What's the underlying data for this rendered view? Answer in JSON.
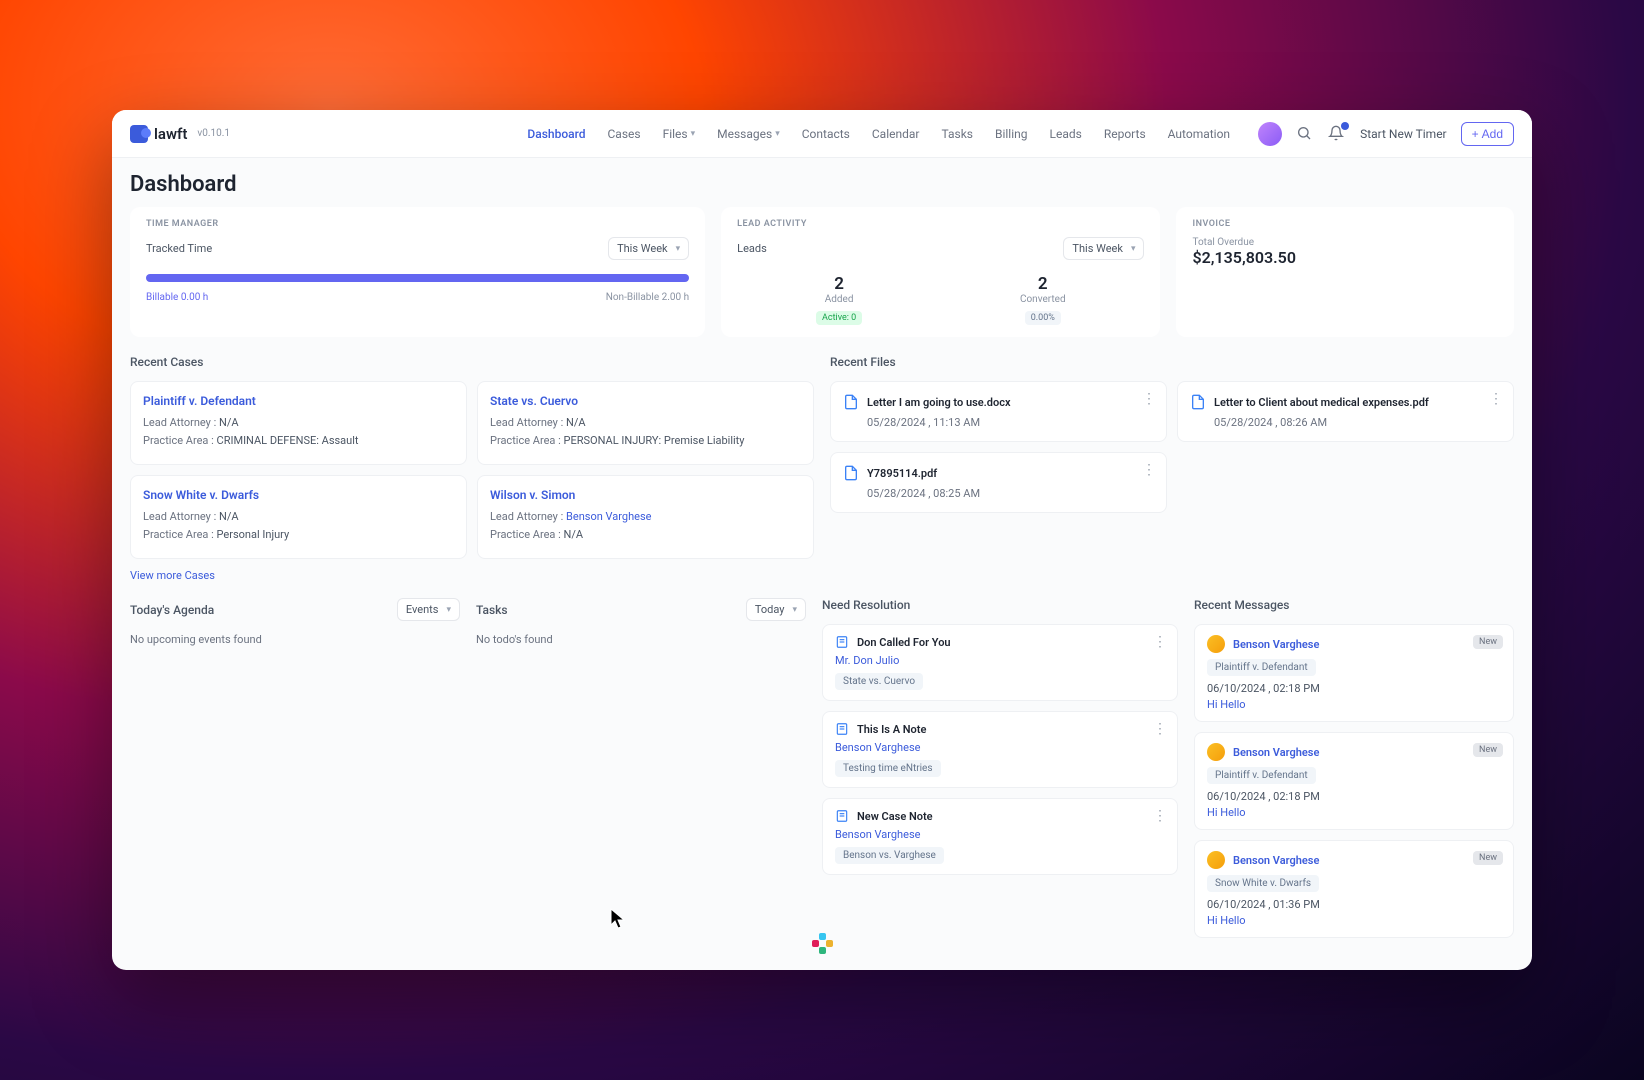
{
  "brand": {
    "name": "lawft",
    "version": "v0.10.1"
  },
  "nav": {
    "dashboard": "Dashboard",
    "cases": "Cases",
    "files": "Files",
    "messages": "Messages",
    "contacts": "Contacts",
    "calendar": "Calendar",
    "tasks": "Tasks",
    "billing": "Billing",
    "leads": "Leads",
    "reports": "Reports",
    "automation": "Automation"
  },
  "top": {
    "timer": "Start New Timer",
    "add": "Add"
  },
  "page_title": "Dashboard",
  "time_manager": {
    "label": "TIME MANAGER",
    "tracked": "Tracked Time",
    "range": "This Week",
    "billable_label": "Billable",
    "billable_val": "0.00 h",
    "nonbillable_label": "Non-Billable",
    "nonbillable_val": "2.00 h"
  },
  "lead_activity": {
    "label": "LEAD ACTIVITY",
    "leads": "Leads",
    "range": "This Week",
    "added": {
      "count": "2",
      "label": "Added",
      "pill": "Active: 0"
    },
    "converted": {
      "count": "2",
      "label": "Converted",
      "pill": "0.00%"
    }
  },
  "invoice": {
    "label": "INVOICE",
    "overdue_label": "Total Overdue",
    "overdue_amount": "$2,135,803.50"
  },
  "recent_cases": {
    "title": "Recent Cases",
    "view_more": "View more Cases",
    "items": [
      {
        "name": "Plaintiff v. Defendant",
        "attorney_label": "Lead Attorney :",
        "attorney": "N/A",
        "area_label": "Practice Area :",
        "area": "CRIMINAL DEFENSE: Assault"
      },
      {
        "name": "State vs. Cuervo",
        "attorney_label": "Lead Attorney :",
        "attorney": "N/A",
        "area_label": "Practice Area :",
        "area": "PERSONAL INJURY: Premise Liability"
      },
      {
        "name": "Snow White v. Dwarfs",
        "attorney_label": "Lead Attorney :",
        "attorney": "N/A",
        "area_label": "Practice Area :",
        "area": "Personal Injury"
      },
      {
        "name": "Wilson v. Simon",
        "attorney_label": "Lead Attorney :",
        "attorney": "Benson Varghese",
        "attorney_link": true,
        "area_label": "Practice Area :",
        "area": "N/A"
      }
    ]
  },
  "recent_files": {
    "title": "Recent Files",
    "items": [
      {
        "name": "Letter I am going to use.docx",
        "time": "05/28/2024 , 11:13 AM"
      },
      {
        "name": "Letter to Client about medical expenses.pdf",
        "time": "05/28/2024 , 08:26 AM"
      },
      {
        "name": "Y7895114.pdf",
        "time": "05/28/2024 , 08:25 AM"
      }
    ]
  },
  "agenda": {
    "title": "Today's Agenda",
    "range": "Events",
    "empty": "No upcoming events found"
  },
  "tasks": {
    "title": "Tasks",
    "range": "Today",
    "empty": "No todo's found"
  },
  "resolution": {
    "title": "Need Resolution",
    "items": [
      {
        "subject": "Don Called For You",
        "person": "Mr. Don Julio",
        "tag": "State vs. Cuervo"
      },
      {
        "subject": "This Is A Note",
        "person": "Benson Varghese",
        "tag": "Testing time eNtries"
      },
      {
        "subject": "New Case Note",
        "person": "Benson Varghese",
        "tag": "Benson vs. Varghese"
      }
    ]
  },
  "messages": {
    "title": "Recent Messages",
    "new_label": "New",
    "items": [
      {
        "name": "Benson Varghese",
        "case": "Plaintiff v. Defendant",
        "time": "06/10/2024 , 02:18 PM",
        "preview": "Hi Hello"
      },
      {
        "name": "Benson Varghese",
        "case": "Plaintiff v. Defendant",
        "time": "06/10/2024 , 02:18 PM",
        "preview": "Hi Hello"
      },
      {
        "name": "Benson Varghese",
        "case": "Snow White v. Dwarfs",
        "time": "06/10/2024 , 01:36 PM",
        "preview": "Hi Hello"
      }
    ]
  }
}
